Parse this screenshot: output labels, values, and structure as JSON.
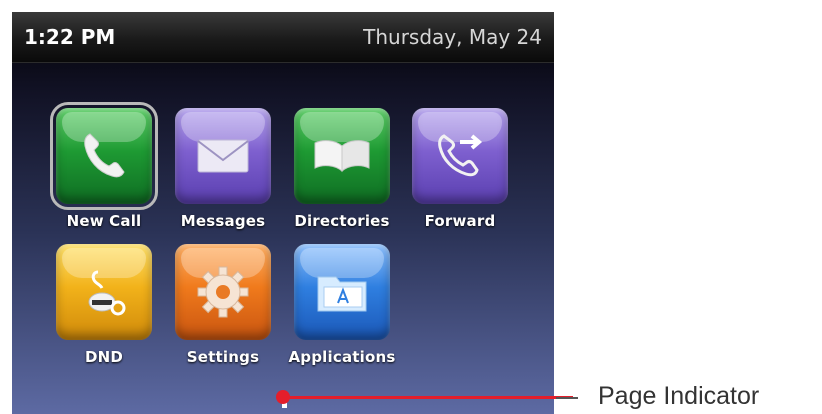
{
  "status": {
    "time": "1:22 PM",
    "date": "Thursday, May 24"
  },
  "apps": [
    {
      "label": "New Call",
      "icon": "phone-handset-icon",
      "color": "#1e9a33"
    },
    {
      "label": "Messages",
      "icon": "envelope-icon",
      "color": "#7e60cf"
    },
    {
      "label": "Directories",
      "icon": "open-book-icon",
      "color": "#1e9a33"
    },
    {
      "label": "Forward",
      "icon": "call-forward-icon",
      "color": "#7e60cf"
    },
    {
      "label": "DND",
      "icon": "do-not-disturb-icon",
      "color": "#f2b21a"
    },
    {
      "label": "Settings",
      "icon": "gear-icon",
      "color": "#f07a1c"
    },
    {
      "label": "Applications",
      "icon": "folder-app-icon",
      "color": "#2f7fe0"
    }
  ],
  "annotation": {
    "label": "Page Indicator",
    "color": "#e41e2b"
  }
}
